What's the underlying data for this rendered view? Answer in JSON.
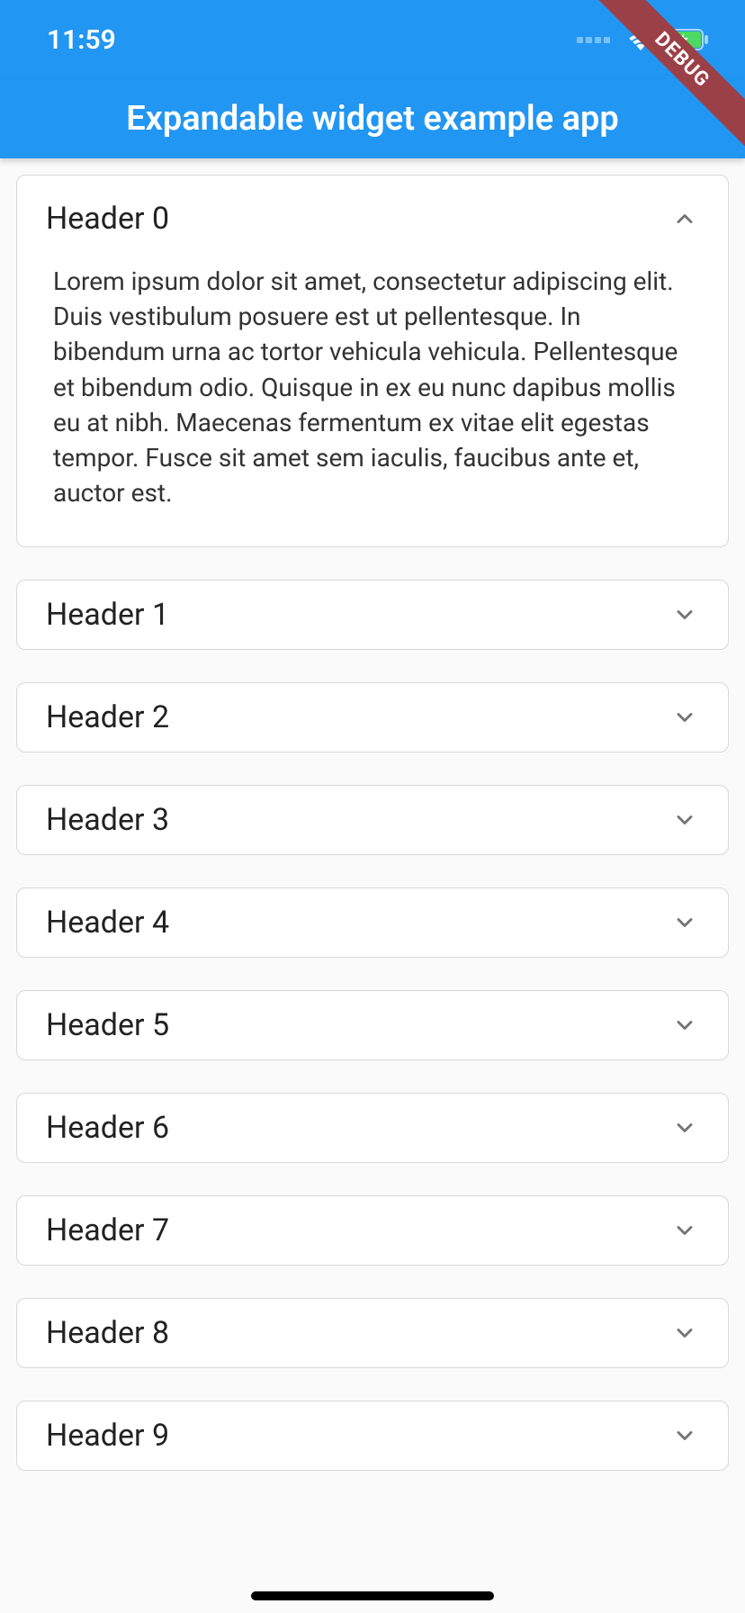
{
  "status_bar": {
    "time": "11:59"
  },
  "debug_label": "DEBUG",
  "app_title": "Expandable widget example app",
  "items": [
    {
      "title": "Header 0",
      "expanded": true,
      "body": "Lorem ipsum dolor sit amet, consectetur adipiscing elit. Duis vestibulum posuere est ut pellentesque. In bibendum urna ac tortor vehicula vehicula. Pellentesque et bibendum odio. Quisque in ex eu nunc dapibus mollis eu at nibh. Maecenas fermentum ex vitae elit egestas tempor. Fusce sit amet sem iaculis, faucibus ante et, auctor est."
    },
    {
      "title": "Header 1",
      "expanded": false
    },
    {
      "title": "Header 2",
      "expanded": false
    },
    {
      "title": "Header 3",
      "expanded": false
    },
    {
      "title": "Header 4",
      "expanded": false
    },
    {
      "title": "Header 5",
      "expanded": false
    },
    {
      "title": "Header 6",
      "expanded": false
    },
    {
      "title": "Header 7",
      "expanded": false
    },
    {
      "title": "Header 8",
      "expanded": false
    },
    {
      "title": "Header 9",
      "expanded": false
    }
  ]
}
